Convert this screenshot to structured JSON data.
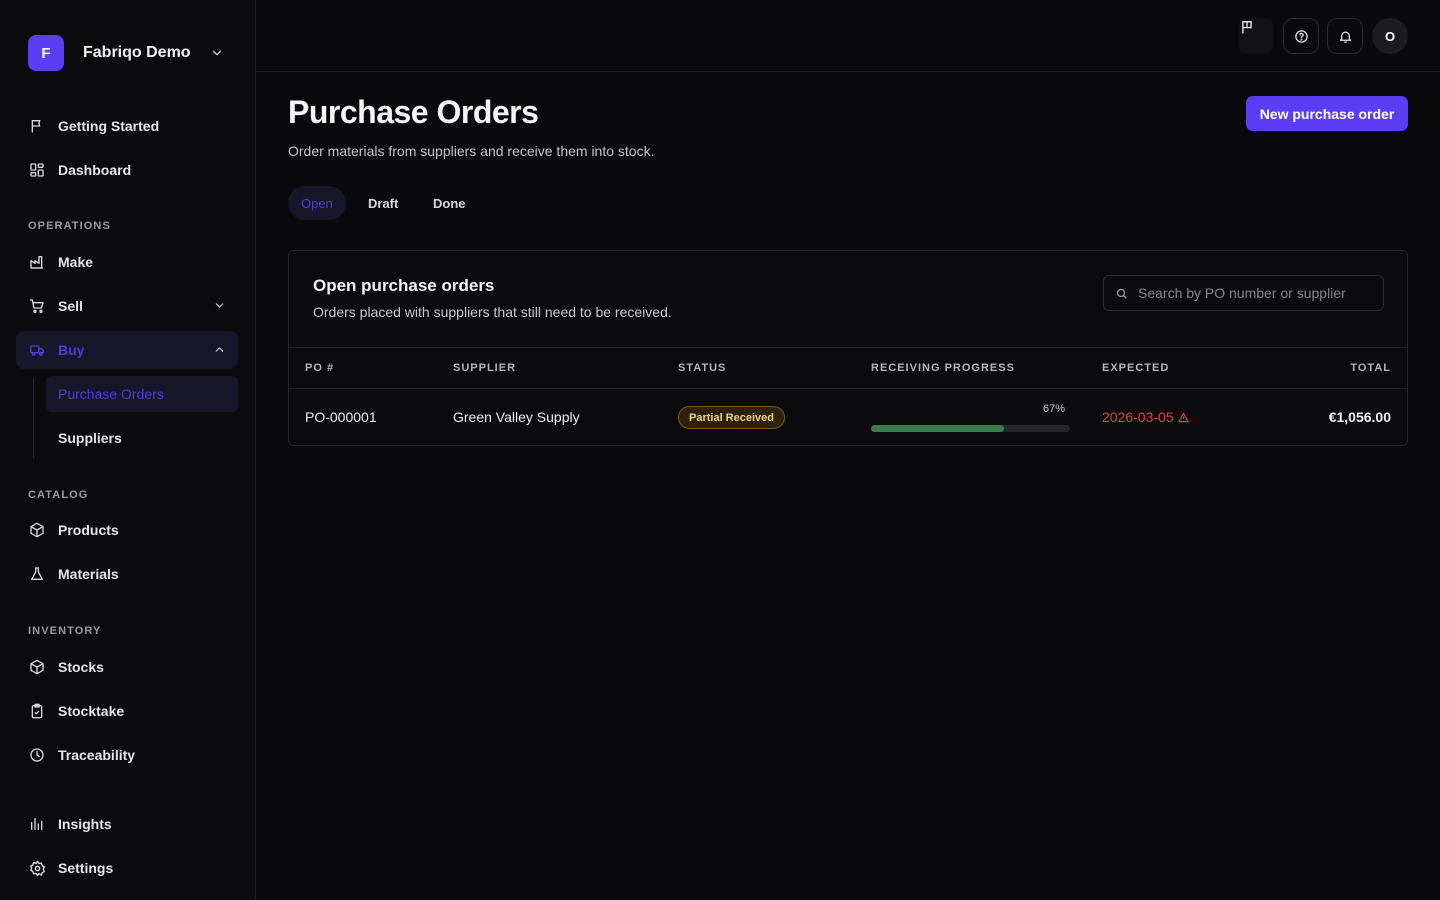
{
  "workspace": {
    "initial": "F",
    "name": "Fabriqo Demo"
  },
  "nav": {
    "getting_started": "Getting Started",
    "dashboard": "Dashboard",
    "operations_label": "OPERATIONS",
    "make": "Make",
    "sell": "Sell",
    "buy": "Buy",
    "buy_children": [
      "Purchase Orders",
      "Suppliers"
    ],
    "catalog_label": "CATALOG",
    "products": "Products",
    "materials": "Materials",
    "inventory_label": "INVENTORY",
    "stocks": "Stocks",
    "stocktake": "Stocktake",
    "traceability": "Traceability",
    "insights": "Insights",
    "settings": "Settings"
  },
  "topbar": {
    "avatar_initial": "O"
  },
  "page": {
    "title": "Purchase Orders",
    "subtitle": "Order materials from suppliers and receive them into stock.",
    "new_button": "New purchase order",
    "tabs": [
      "Open",
      "Draft",
      "Done"
    ],
    "active_tab": "Open"
  },
  "card": {
    "title": "Open purchase orders",
    "subtitle": "Orders placed with suppliers that still need to be received.",
    "search_placeholder": "Search by PO number or supplier"
  },
  "table": {
    "columns": [
      "PO #",
      "SUPPLIER",
      "STATUS",
      "RECEIVING PROGRESS",
      "EXPECTED",
      "TOTAL"
    ],
    "rows": [
      {
        "po": "PO-000001",
        "supplier": "Green Valley Supply",
        "status": "Partial Received",
        "progress_label": "67%",
        "progress": 0.67,
        "expected": "2026-03-05",
        "total": "€1,056.00"
      }
    ]
  },
  "colors": {
    "accent": "#5b3df5",
    "active_text": "#4f3fd6",
    "overdue": "#e2473f",
    "progress": "#3d7a4c",
    "badge_text": "#f0d089"
  }
}
